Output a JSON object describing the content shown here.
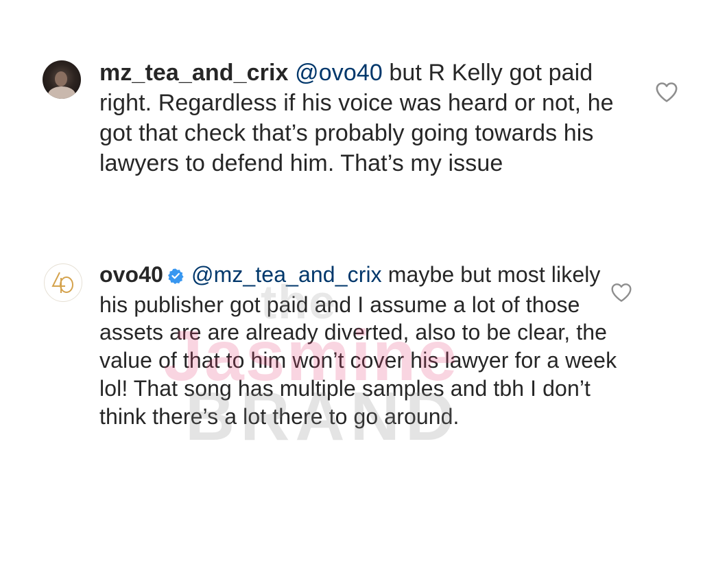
{
  "comments": [
    {
      "username": "mz_tea_and_crix",
      "mention": "@ovo40",
      "text": " but R Kelly got paid right. Regardless if his voice was heard or not, he got that check that’s probably going towards his lawyers to defend him. That’s my issue",
      "verified": false,
      "avatar_icon": "profile-photo"
    },
    {
      "username": "ovo40",
      "mention": "@mz_tea_and_crix",
      "text": " maybe but most likely his publisher got paid and I assume a lot of those assets are are already diverted, also to be clear, the value of that to him won’t cover his lawyer for a week lol! That song has multiple samples and tbh I don’t think there’s a lot there to go around.",
      "verified": true,
      "avatar_icon": "ovo40-logo"
    }
  ],
  "watermark": {
    "line1": "the",
    "line2": "Jasmine",
    "line3": "BRAND"
  },
  "colors": {
    "text": "#262626",
    "mention": "#00376b",
    "verified_badge": "#3897f0",
    "heart_outline": "#8e8e8e",
    "logo_gold": "#d4a24c"
  }
}
